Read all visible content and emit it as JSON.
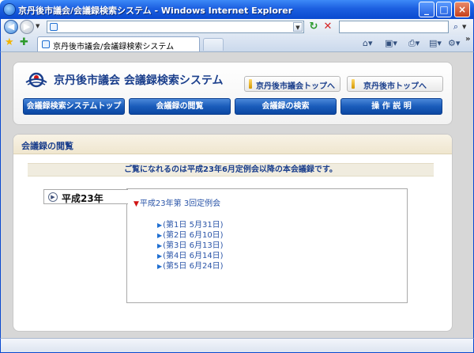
{
  "window": {
    "title": "京丹後市議会/会議録検索システム - Windows Internet Explorer"
  },
  "browser": {
    "address_value": "",
    "search_value": "",
    "tab_label": "京丹後市議会/会議録検索システム"
  },
  "header": {
    "site_title": "京丹後市議会 会議録検索システム",
    "top_links": [
      {
        "label": "京丹後市議会トップへ"
      },
      {
        "label": "京丹後市トップへ"
      }
    ],
    "menu": [
      {
        "label": "会議録検索システムトップ"
      },
      {
        "label": "会議録の閲覧"
      },
      {
        "label": "会議録の検索"
      },
      {
        "label": "操 作 説 明"
      }
    ]
  },
  "content": {
    "section_title": "会議録の閲覧",
    "notice": "ご覧になれるのは平成23年6月定例会以降の本会議録です。",
    "year_label": "平成23年",
    "session_title": "平成23年第 3回定例会",
    "days": [
      {
        "label": "(第1日 5月31日)"
      },
      {
        "label": "(第2日 6月10日)"
      },
      {
        "label": "(第3日 6月13日)"
      },
      {
        "label": "(第4日 6月14日)"
      },
      {
        "label": "(第5日 6月24日)"
      }
    ]
  },
  "colors": {
    "title_blue": "#1b3f8c",
    "link_blue": "#2b55a8",
    "menu_button": "#1a5cba",
    "marker_red": "#d01414"
  },
  "icons": {
    "back": "back-arrow-icon",
    "forward": "forward-arrow-icon",
    "refresh": "refresh-icon",
    "stop": "stop-icon",
    "search": "search-icon",
    "favorites": "favorites-star-icon",
    "home": "home-icon",
    "feeds": "feeds-icon",
    "print": "print-icon",
    "page": "page-icon",
    "tools": "tools-gear-icon"
  }
}
